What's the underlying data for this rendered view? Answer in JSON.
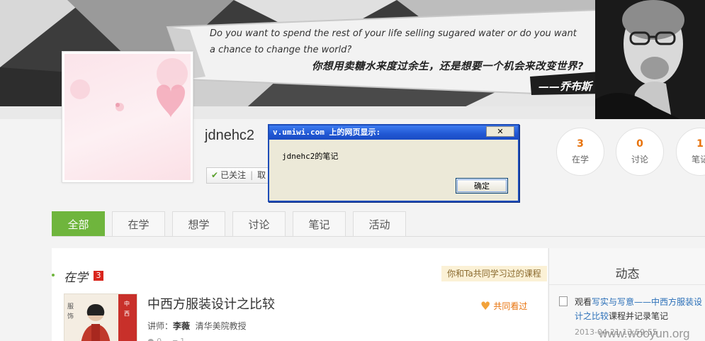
{
  "banner": {
    "quote_en": "Do you want to spend the rest of your life selling sugared water or do you want a chance to change the world?",
    "quote_cn": "你想用卖糖水来度过余生，还是想要一个机会来改变世界?",
    "quote_by": "——乔布斯"
  },
  "profile": {
    "username": "jdnehc2",
    "follow_label": "已关注",
    "follow_more": "取"
  },
  "stats": [
    {
      "num": "3",
      "label": "在学"
    },
    {
      "num": "0",
      "label": "讨论"
    },
    {
      "num": "1",
      "label": "笔记"
    }
  ],
  "tabs": [
    "全部",
    "在学",
    "想学",
    "讨论",
    "笔记",
    "活动"
  ],
  "section": {
    "title": "在学",
    "badge": "3",
    "together_tag": "你和Ta共同学习过的课程"
  },
  "course": {
    "title": "中西方服装设计之比较",
    "teacher_label": "讲师：",
    "teacher_name": "李薇",
    "teacher_org": "清华美院教授",
    "co_watch": "共同看过",
    "views": "0",
    "comments": "1"
  },
  "sidebar": {
    "title": "动态",
    "feed_prefix": "观看",
    "feed_link": "写实与写意——中西方服装设计之比较",
    "feed_suffix": "课程并记录笔记",
    "feed_time": "2013-04-21 13:59:55"
  },
  "dialog": {
    "title": "v.umiwi.com 上的网页显示:",
    "message": "jdnehc2的笔记",
    "ok_label": "确定",
    "close_label": "✕"
  },
  "watermark": "www.wooyun.org",
  "colors": {
    "accent_green": "#6fb53d",
    "stat_orange": "#e8730c",
    "badge_red": "#d9251c",
    "xp_blue": "#2157d3"
  }
}
